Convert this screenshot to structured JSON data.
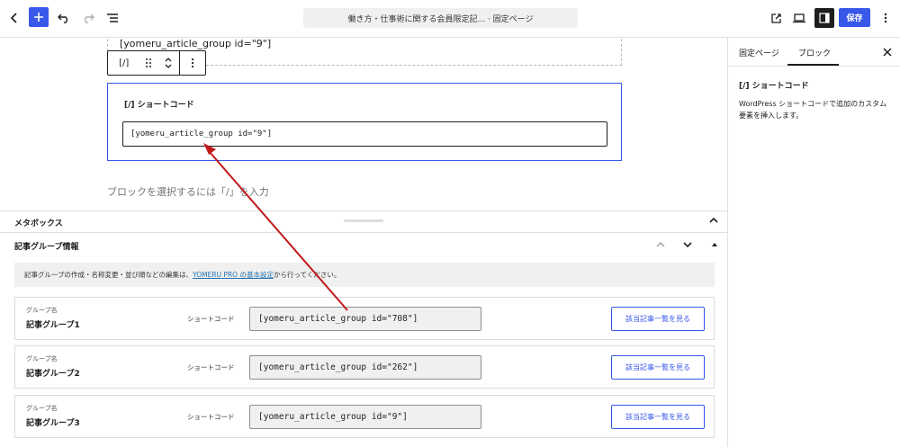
{
  "topbar": {
    "doc_title": "働き方・仕事術に関する会員限定記... · 固定ページ",
    "save_label": "保存"
  },
  "sidebar": {
    "tab_page": "固定ページ",
    "tab_block": "ブロック",
    "block_title": "[/]  ショートコード",
    "block_desc": "WordPress ショートコードで追加のカスタム要素を挿入します。"
  },
  "canvas": {
    "prev_block_text": "[yomeru_article_group id=\"9\"]",
    "toolbar_shortcode_icon": "[/]",
    "shortcode_label": "[/]  ショートコード",
    "shortcode_value": "[yomeru_article_group id=\"9\"]",
    "placeholder": "ブロックを選択するには「/」を入力"
  },
  "metabox": {
    "title": "メタボックス",
    "panel_title": "記事グループ情報",
    "notice_before": "記事グループの作成・名称変更・並び順などの編集は、",
    "notice_link": "YOMERU PRO の基本設定",
    "notice_after": "から行ってください。",
    "groups": [
      {
        "label": "グループ名",
        "name": "記事グループ1",
        "sc_label": "ショートコード",
        "sc_value": "[yomeru_article_group id=\"708\"]",
        "button": "該当記事一覧を見る"
      },
      {
        "label": "グループ名",
        "name": "記事グループ2",
        "sc_label": "ショートコード",
        "sc_value": "[yomeru_article_group id=\"262\"]",
        "button": "該当記事一覧を見る"
      },
      {
        "label": "グループ名",
        "name": "記事グループ3",
        "sc_label": "ショートコード",
        "sc_value": "[yomeru_article_group id=\"9\"]",
        "button": "該当記事一覧を見る"
      }
    ]
  },
  "colors": {
    "accent": "#3858e9",
    "annotation_arrow": "#c0191b"
  }
}
